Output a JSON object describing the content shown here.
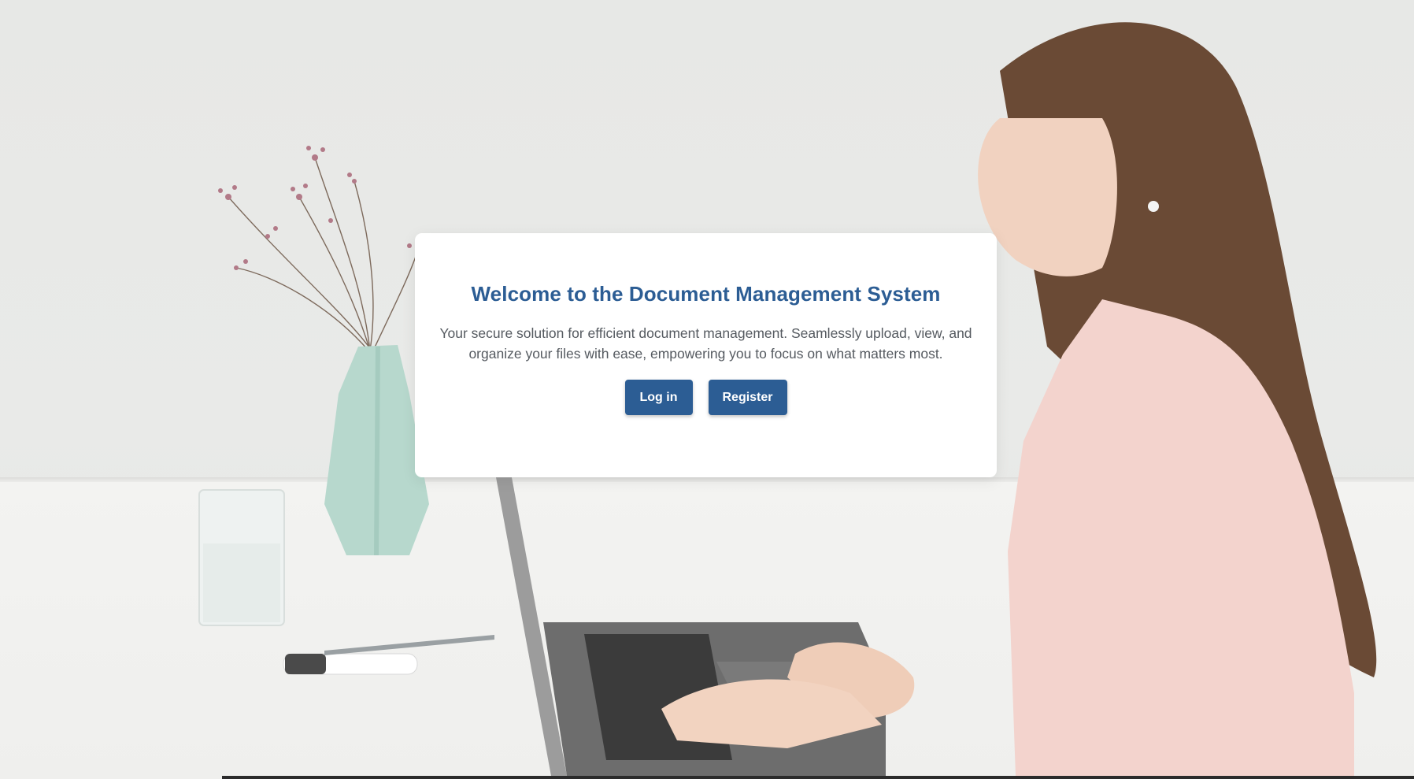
{
  "hero": {
    "title": "Welcome to the Document Management System",
    "description": "Your secure solution for efficient document management. Seamlessly upload, view, and organize your files with ease, empowering you to focus on what matters most."
  },
  "actions": {
    "login_label": "Log in",
    "register_label": "Register"
  },
  "colors": {
    "accent": "#2c5d94",
    "background": "#e8e9e7",
    "card": "#ffffff",
    "body_text": "#555a60"
  },
  "background_image": "woman-typing-on-laptop-at-desk-with-vase-and-glass"
}
